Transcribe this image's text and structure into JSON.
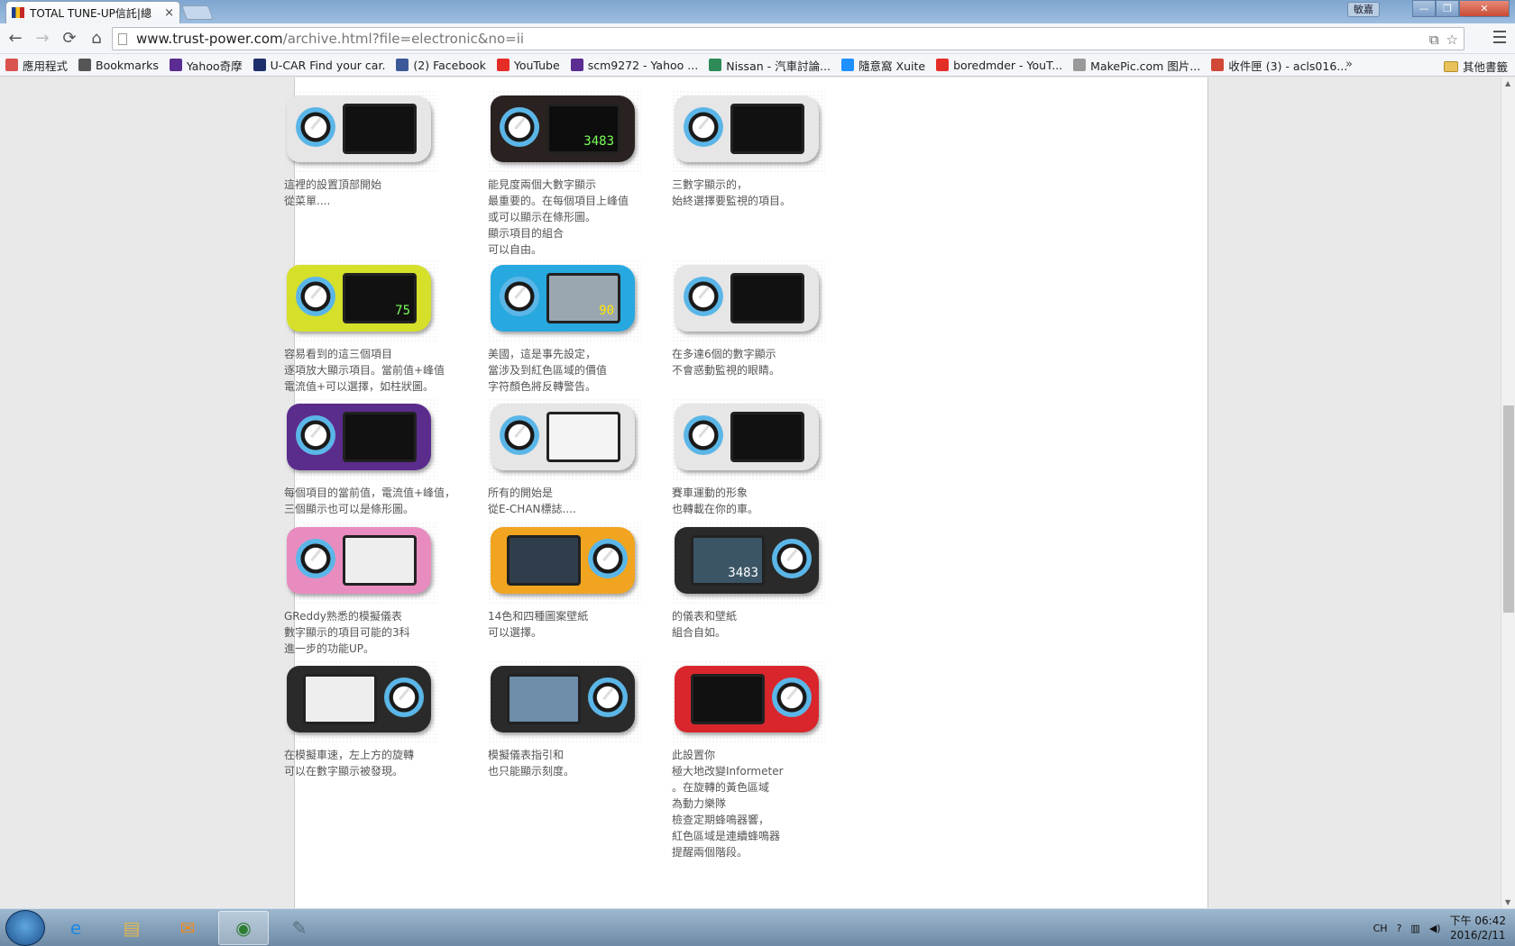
{
  "browser": {
    "tab_title": "TOTAL TUNE-UP信託|總",
    "tab_close": "×",
    "user_badge": "敏嘉",
    "min": "—",
    "max": "❐",
    "close": "✕",
    "url_host": "www.trust-power.com",
    "url_path": "/archive.html?file=electronic&no=ii",
    "nav": {
      "back": "←",
      "forward": "→",
      "reload": "⟳",
      "home": "⌂"
    },
    "omni_icons": {
      "translate": "⧉",
      "star": "☆"
    },
    "bookmarks": [
      {
        "label": "應用程式",
        "icon": "apps-icon",
        "color": "#d9534f"
      },
      {
        "label": "Bookmarks",
        "icon": "star-icon",
        "color": "#555555"
      },
      {
        "label": "Yahoo奇摩",
        "icon": "yahoo-icon",
        "color": "#5b2c91"
      },
      {
        "label": "U-CAR Find your car.",
        "icon": "ucar-icon",
        "color": "#1d2f6b"
      },
      {
        "label": "(2) Facebook",
        "icon": "facebook-icon",
        "color": "#3b5998"
      },
      {
        "label": "YouTube",
        "icon": "youtube-icon",
        "color": "#e52d27"
      },
      {
        "label": "scm9272 - Yahoo ...",
        "icon": "yahoo-mail-icon",
        "color": "#5b2c91"
      },
      {
        "label": "Nissan - 汽車討論...",
        "icon": "forum-icon",
        "color": "#2e8b57"
      },
      {
        "label": "隨意窩 Xuite",
        "icon": "xuite-icon",
        "color": "#1e90ff"
      },
      {
        "label": "boredmder - YouT...",
        "icon": "youtube-icon",
        "color": "#e52d27"
      },
      {
        "label": "MakePic.com 图片...",
        "icon": "page-icon",
        "color": "#999999"
      },
      {
        "label": "收件匣 (3) - acls016...",
        "icon": "gmail-icon",
        "color": "#d14836"
      }
    ],
    "bookmarks_more": "»",
    "other_bookmarks": "其他書籤"
  },
  "products": [
    {
      "caption": "這裡的設置頂部開始\n從菜單....",
      "body": "#e6e6e6",
      "screen": "#111111",
      "text": "",
      "text_color": "#ffffff",
      "dial_left": true
    },
    {
      "caption": "能見度兩個大數字顯示\n最重要的。在每個項目上峰值\n或可以顯示在條形圖。\n顯示項目的組合\n可以自由。",
      "body": "#2a2220",
      "screen": "#0d0d0d",
      "text": "3483",
      "text_color": "#7cff5a",
      "dial_left": true
    },
    {
      "caption": "三數字顯示的，\n始終選擇要監視的項目。",
      "body": "#e6e6e6",
      "screen": "#111111",
      "text": "",
      "text_color": "#ffffff",
      "dial_left": true
    },
    {
      "caption": "容易看到的這三個項目\n逐項放大顯示項目。當前值+峰值\n電流值+可以選擇，如柱狀圖。",
      "body": "#d6e02a",
      "screen": "#111111",
      "text": "75",
      "text_color": "#7cff5a",
      "dial_left": true
    },
    {
      "caption": "美國，這是事先設定，\n當涉及到紅色區域的價值\n字符顏色將反轉警告。",
      "body": "#27a8df",
      "screen": "#9aa7b0",
      "text": "90",
      "text_color": "#ffe600",
      "dial_left": true
    },
    {
      "caption": "在多達6個的數字顯示\n不會惑動監視的眼睛。",
      "body": "#e6e6e6",
      "screen": "#111111",
      "text": "",
      "text_color": "#ffe600",
      "dial_left": true
    },
    {
      "caption": "每個項目的當前值，電流值+峰值，\n三個顯示也可以是條形圖。",
      "body": "#5a2c8c",
      "screen": "#111111",
      "text": "",
      "text_color": "#7cff5a",
      "dial_left": true
    },
    {
      "caption": "所有的開始是\n從E-CHAN標誌....",
      "body": "#e6e6e6",
      "screen": "#f4f4f4",
      "text": "",
      "text_color": "#222222",
      "dial_left": true
    },
    {
      "caption": "賽車運動的形象\n也轉載在你的車。",
      "body": "#e6e6e6",
      "screen": "#111111",
      "text": "",
      "text_color": "#ffffff",
      "dial_left": true
    },
    {
      "caption": "GReddy熟悉的模擬儀表\n數字顯示的項目可能的3科\n進一步的功能UP。",
      "body": "#e88cc0",
      "screen": "#eeeeee",
      "text": "",
      "text_color": "#222222",
      "dial_left": true
    },
    {
      "caption": "14色和四種圖案壁紙\n可以選擇。",
      "body": "#f0a41f",
      "screen": "#2f3e4a",
      "text": "",
      "text_color": "#ffffff",
      "dial_left": false
    },
    {
      "caption": "的儀表和壁紙\n組合自如。",
      "body": "#2a2a2a",
      "screen": "#3b5566",
      "text": "3483",
      "text_color": "#ffffff",
      "dial_left": false
    },
    {
      "caption": "在模擬車速，左上方的旋轉\n可以在數字顯示被發現。",
      "body": "#2a2a2a",
      "screen": "#eeeeee",
      "text": "",
      "text_color": "#222222",
      "dial_left": false
    },
    {
      "caption": "模擬儀表指引和\n也只能顯示刻度。",
      "body": "#2a2a2a",
      "screen": "#6d8da8",
      "text": "",
      "text_color": "#ffffff",
      "dial_left": false
    },
    {
      "caption": "此設置你\n極大地改變Informeter\n。在旋轉的黃色區域\n為動力樂隊\n檢查定期蜂鳴器響，\n紅色區域是連續蜂鳴器\n提醒兩個階段。",
      "body": "#d9262c",
      "screen": "#111111",
      "text": "",
      "text_color": "#ffffff",
      "dial_left": false
    }
  ],
  "taskbar": {
    "tasks": [
      {
        "name": "ie-icon",
        "glyph": "e",
        "color": "#1e88e5"
      },
      {
        "name": "explorer-icon",
        "glyph": "▤",
        "color": "#e5b64a"
      },
      {
        "name": "outlook-icon",
        "glyph": "✉",
        "color": "#f08a1a"
      },
      {
        "name": "chrome-icon",
        "glyph": "◉",
        "color": "#2e7d32"
      },
      {
        "name": "paint-icon",
        "glyph": "✎",
        "color": "#546e7a"
      }
    ],
    "tray_lang": "CH",
    "tray_help": "?",
    "time": "下午 06:42",
    "date": "2016/2/11"
  }
}
